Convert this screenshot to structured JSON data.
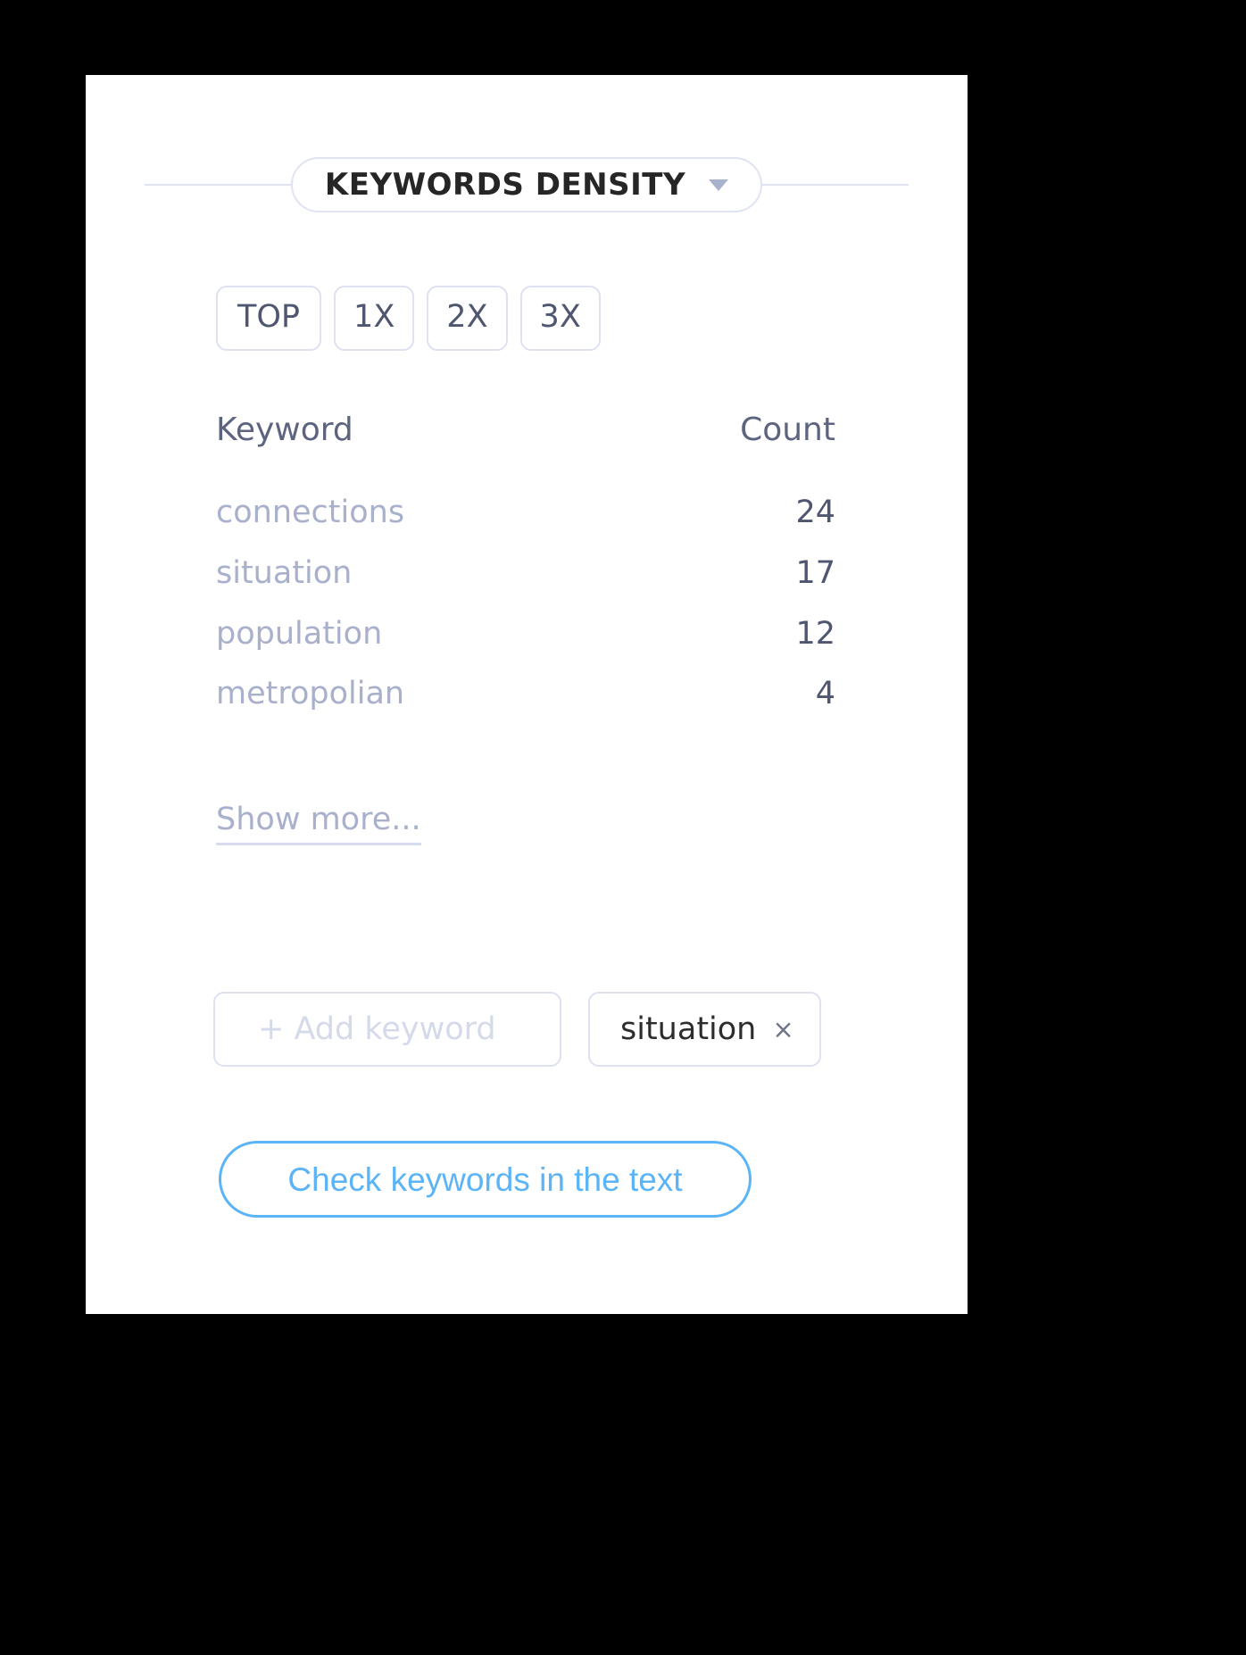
{
  "panel": {
    "title": "KEYWORDS DENSITY",
    "dropdown_icon": "chevron-down-icon"
  },
  "filters": {
    "options": [
      {
        "label": "TOP"
      },
      {
        "label": "1X"
      },
      {
        "label": "2X"
      },
      {
        "label": "3X"
      }
    ]
  },
  "table": {
    "headers": {
      "keyword": "Keyword",
      "count": "Count"
    },
    "rows": [
      {
        "keyword": "connections",
        "count": "24"
      },
      {
        "keyword": "situation",
        "count": "17"
      },
      {
        "keyword": "population",
        "count": "12"
      },
      {
        "keyword": "metropolian",
        "count": "4"
      }
    ]
  },
  "show_more": {
    "label": "Show more..."
  },
  "keyword_entry": {
    "add_placeholder": "+ Add keyword",
    "chips": [
      {
        "label": "situation",
        "remove_icon": "×"
      }
    ]
  },
  "cta": {
    "label": "Check keywords in the text"
  },
  "colors": {
    "accent_blue": "#5bb4f7",
    "border_lavender": "#dde1f1",
    "text_slate": "#4f566f",
    "text_muted": "#a8b0cb",
    "placeholder": "#d5daeb",
    "page_background": "#000000",
    "card_background": "#ffffff"
  }
}
